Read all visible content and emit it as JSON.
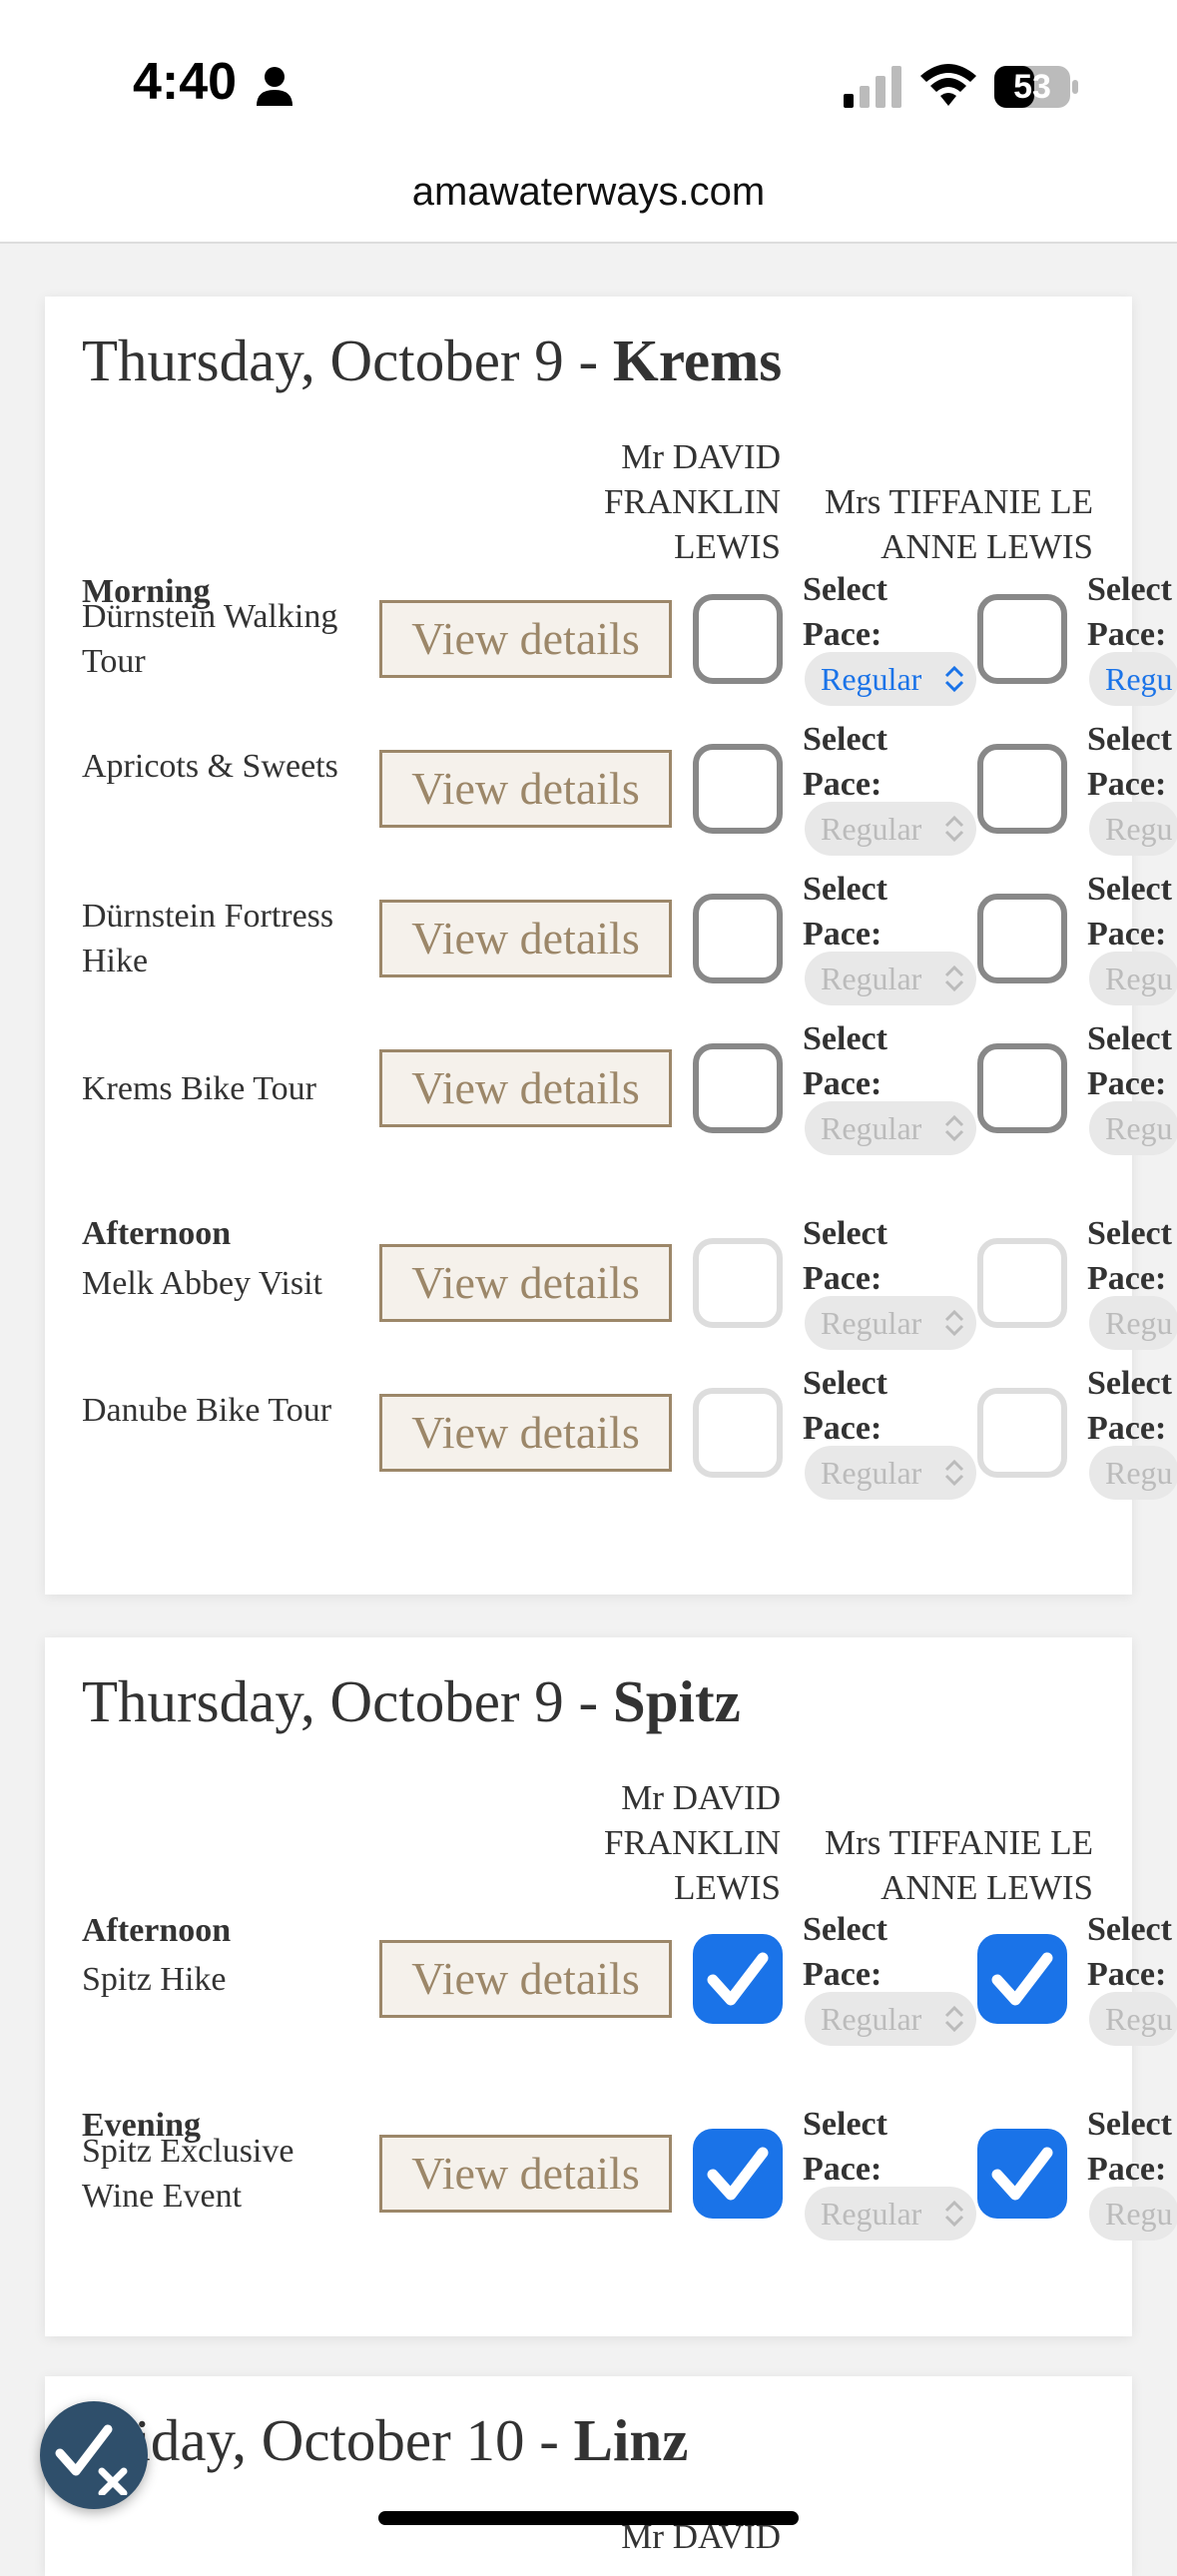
{
  "status": {
    "time": "4:40",
    "battery": "53"
  },
  "browser": {
    "url": "amawaterways.com"
  },
  "guests": {
    "g1": [
      "Mr DAVID",
      "FRANKLIN",
      "LEWIS"
    ],
    "g2": [
      "Mrs TIFFANIE LE",
      "ANNE LEWIS"
    ]
  },
  "krems": {
    "title_prefix": "Thursday, October 9 - ",
    "title_place": "Krems",
    "morning": "Morning",
    "afternoon": "Afternoon",
    "tours": [
      {
        "name": "Dürnstein Walking Tour",
        "pace": "Regular"
      },
      {
        "name": "Apricots & Sweets",
        "pace": "Regular"
      },
      {
        "name": "Dürnstein Fortress Hike",
        "pace": "Regular"
      },
      {
        "name": "Krems Bike Tour",
        "pace": "Regular"
      },
      {
        "name": "Melk Abbey Visit",
        "pace": "Regular"
      },
      {
        "name": "Danube Bike Tour",
        "pace": "Regular"
      }
    ]
  },
  "spitz": {
    "title_prefix": "Thursday, October 9 - ",
    "title_place": "Spitz",
    "afternoon": "Afternoon",
    "evening": "Evening",
    "tours": [
      {
        "name": "Spitz Hike",
        "pace": "Regular"
      },
      {
        "name": "Spitz Exclusive Wine Event",
        "pace": "Regular"
      }
    ]
  },
  "linz": {
    "title_prefix": "Friday, October 10 - ",
    "title_place": "Linz",
    "guest_partial": "Mr DAVID"
  },
  "labels": {
    "view_details": "View details",
    "select": "Select",
    "pace": "Pace:",
    "regu": "Regu"
  }
}
